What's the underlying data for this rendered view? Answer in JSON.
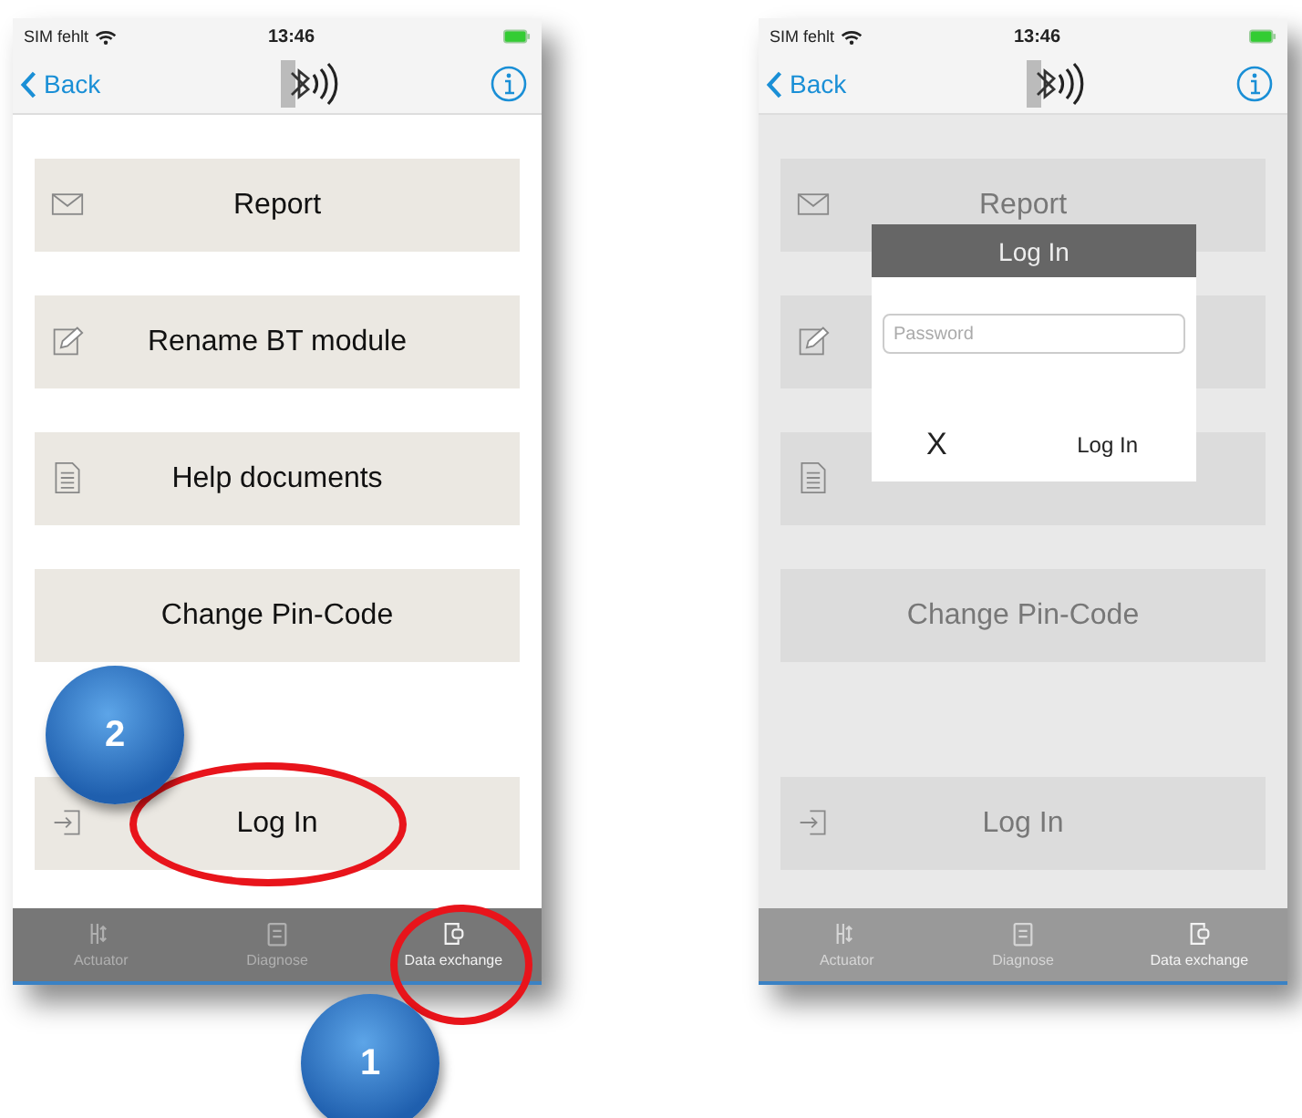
{
  "screens": [
    {
      "dimmed": false,
      "status_bar": {
        "carrier": "SIM fehlt",
        "time": "13:46"
      },
      "nav": {
        "back": "Back"
      },
      "menu": [
        {
          "kind": "mail",
          "label": "Report"
        },
        {
          "kind": "edit",
          "label": "Rename BT module"
        },
        {
          "kind": "document",
          "label": "Help documents"
        },
        {
          "kind": "plain",
          "label": "Change Pin-Code"
        },
        {
          "kind": "login",
          "label": "Log In"
        }
      ],
      "tabs": [
        {
          "label": "Actuator",
          "selected": false
        },
        {
          "label": "Diagnose",
          "selected": false
        },
        {
          "label": "Data exchange",
          "selected": true
        }
      ]
    },
    {
      "dimmed": true,
      "status_bar": {
        "carrier": "SIM fehlt",
        "time": "13:46"
      },
      "nav": {
        "back": "Back"
      },
      "menu": [
        {
          "kind": "mail",
          "label": "Report"
        },
        {
          "kind": "edit"
        },
        {
          "kind": "document"
        },
        {
          "kind": "plain",
          "label": "Change Pin-Code"
        },
        {
          "kind": "login",
          "label": "Log In"
        }
      ],
      "tabs": [
        {
          "label": "Actuator",
          "selected": false
        },
        {
          "label": "Diagnose",
          "selected": false
        },
        {
          "label": "Data exchange",
          "selected": true
        }
      ],
      "dialog": {
        "title": "Log In",
        "placeholder": "Password",
        "cancel": "X",
        "confirm": "Log In"
      }
    }
  ],
  "annotations": [
    {
      "number": "2"
    },
    {
      "number": "1"
    }
  ]
}
